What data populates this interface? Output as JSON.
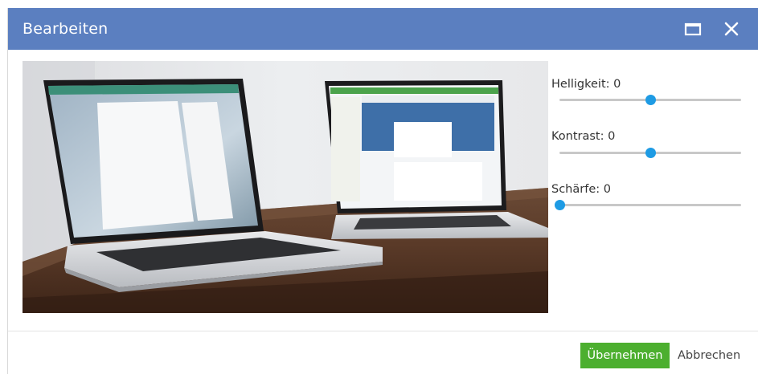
{
  "dialog": {
    "title": "Bearbeiten",
    "maximize_icon": "maximize-icon",
    "close_icon": "close-icon"
  },
  "controls": [
    {
      "label": "Helligkeit: 0",
      "value": 0,
      "min": -100,
      "max": 100
    },
    {
      "label": "Kontrast: 0",
      "value": 0,
      "min": -100,
      "max": 100
    },
    {
      "label": "Schärfe: 0",
      "value": 0,
      "min": 0,
      "max": 100
    }
  ],
  "footer": {
    "apply_label": "Übernehmen",
    "cancel_label": "Abbrechen"
  },
  "colors": {
    "titlebar": "#5b7fc0",
    "apply": "#4caf2f",
    "slider_thumb": "#1e9be4"
  }
}
